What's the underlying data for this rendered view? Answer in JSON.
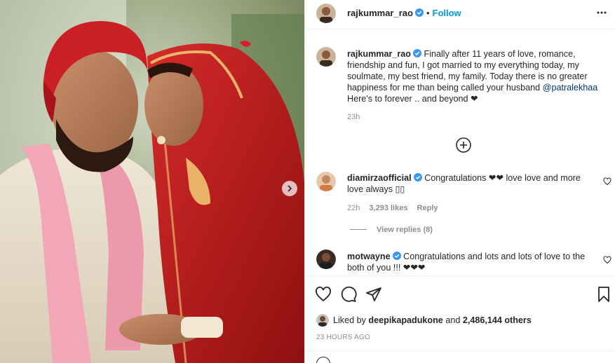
{
  "header": {
    "username": "rajkummar_rao",
    "separator": "•",
    "follow_label": "Follow",
    "more_icon": "more-horizontal-icon"
  },
  "caption": {
    "username": "rajkummar_rao",
    "text": "Finally after 11 years of love, romance, friendship and fun, I got married to my everything today, my soulmate, my best friend, my family. Today there is no greater happiness for me than being called your husband",
    "mention": "@patralekhaa",
    "line2": "Here's to forever .. and beyond ❤",
    "time": "23h"
  },
  "comments": [
    {
      "username": "diamirzaofficial",
      "text": "Congratulations ❤❤ love love and more love always ▯▯",
      "time": "22h",
      "likes": "3,293 likes",
      "reply_label": "Reply",
      "view_replies": "View replies (8)"
    },
    {
      "username": "motwayne",
      "text": "Congratulations and lots and lots of love to the both of you !!! ❤❤❤"
    }
  ],
  "likes": {
    "prefix": "Liked by",
    "user": "deepikapadukone",
    "and": "and",
    "others": "2,486,144 others"
  },
  "posted": "23 HOURS AGO",
  "colors": {
    "accent": "#0095f6",
    "mention": "#00376b",
    "muted": "#8e8e8e",
    "text": "#262626",
    "verified": "#3897f0"
  }
}
